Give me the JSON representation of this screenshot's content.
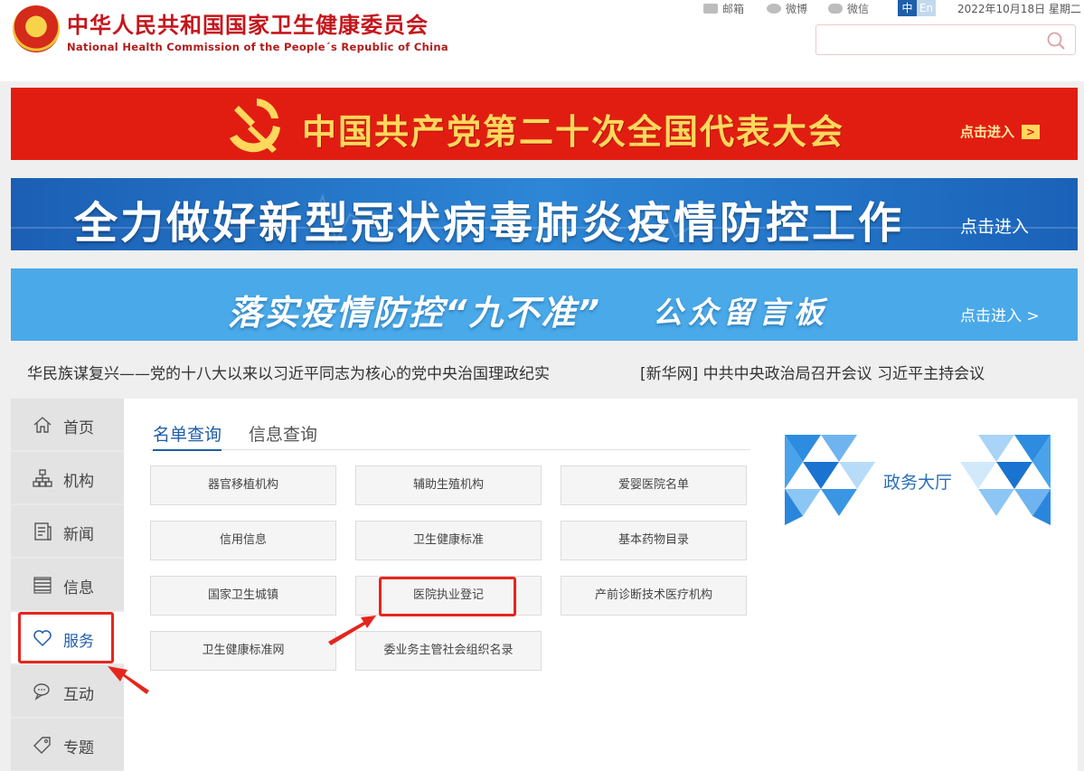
{
  "site": {
    "name_cn": "中华人民共和国国家卫生健康委员会",
    "name_en": "National Health Commission of the People´s Republic of China"
  },
  "toplinks": {
    "mail": "邮箱",
    "weibo": "微博",
    "wechat": "微信"
  },
  "lang": {
    "zh": "中",
    "en": "En"
  },
  "date": "2022年10月18日 星期二",
  "search": {
    "value": "",
    "placeholder": ""
  },
  "banners": {
    "congress": {
      "title": "中国共产党第二十次全国代表大会",
      "enter": "点击进入"
    },
    "covid": {
      "title": "全力做好新型冠状病毒肺炎疫情防控工作",
      "enter": "点击进入"
    },
    "board": {
      "title": "落实疫情防控“九不准”",
      "subtitle": "公众留言板",
      "enter": "点击进入 >"
    }
  },
  "ticker": {
    "items": [
      "华民族谋复兴——党的十八大以来以习近平同志为核心的党中央治国理政纪实",
      "[新华网] 中共中央政治局召开会议 习近平主持会议"
    ]
  },
  "nav": {
    "items": [
      {
        "label": "首页",
        "icon": "home-icon"
      },
      {
        "label": "机构",
        "icon": "org-icon"
      },
      {
        "label": "新闻",
        "icon": "news-icon"
      },
      {
        "label": "信息",
        "icon": "info-icon"
      },
      {
        "label": "服务",
        "icon": "heart-icon"
      },
      {
        "label": "互动",
        "icon": "chat-icon"
      },
      {
        "label": "专题",
        "icon": "tag-icon"
      }
    ],
    "active": "服务"
  },
  "tabs": {
    "list_query": "名单查询",
    "info_query": "信息查询"
  },
  "services": {
    "items": [
      "器官移植机构",
      "辅助生殖机构",
      "爱婴医院名单",
      "信用信息",
      "卫生健康标准",
      "基本药物目录",
      "国家卫生城镇",
      "医院执业登记",
      "产前诊断技术医疗机构",
      "卫生健康标准网",
      "委业务主管社会组织名录"
    ]
  },
  "hall": {
    "label": "政务大厅"
  },
  "colors": {
    "brand_red": "#c4161c",
    "accent_blue": "#1f5ea8",
    "annotation_red": "#e5261e"
  }
}
